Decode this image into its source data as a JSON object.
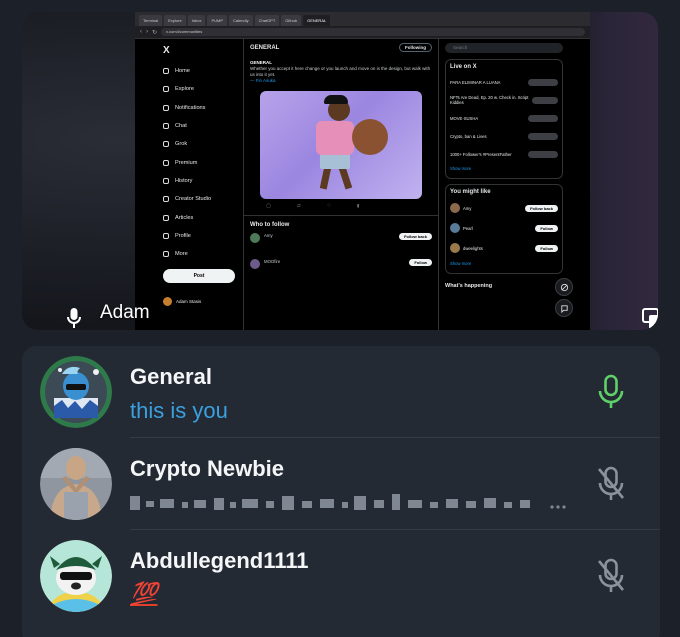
{
  "tile": {
    "name": "Adam",
    "mic_icon": "microphone-icon",
    "copy_icon": "copy-windows-icon"
  },
  "screen": {
    "browser_tabs": [
      "Terminal",
      "Explore",
      "Inbox",
      "PUMP",
      "Calendly",
      "ChatGPT",
      "Github",
      "GENERAL"
    ],
    "url": "x.com/i/communities",
    "x": {
      "logo": "X",
      "nav": [
        "Home",
        "Explore",
        "Notifications",
        "Chat",
        "Grok",
        "Premium",
        "History",
        "Creator Studio",
        "Articles",
        "Profile",
        "More"
      ],
      "post_button": "Post",
      "account_name": "Adam Stasis",
      "main_title": "GENERAL",
      "following_button": "Following",
      "tweet_author": "GENERAL",
      "tweet_text": "Whether you accept it here change or you launch and move on is the design, but walk with us into it yet.",
      "tweet_link": "— Fin Asuka",
      "who_to_follow": "Who to follow",
      "follow_label": "Follow back",
      "follow_label_2": "Follow",
      "follow_name_1": "Amy",
      "follow_name_2": "MOOfire",
      "search_placeholder": "Search",
      "live_title": "Live on X",
      "live_items": [
        "PARA ELIMINAR A LUANA",
        "NFTs Are Dead, Ep. 20 w. Check in. Script Kiddies",
        "MOVE-SUSHA",
        "Crypto, ban & Lives",
        "1000+ Follower's #PresentFather"
      ],
      "show_more": "Show more",
      "yml_title": "You might like",
      "yml_items": [
        "Amy",
        "Pearl",
        "dweelights"
      ],
      "happening_title": "What's happening"
    }
  },
  "participants": [
    {
      "name": "General",
      "status": "this is you",
      "status_color": "#3aa0e0",
      "mic": "mic-active-icon",
      "mic_color": "#5fd16a"
    },
    {
      "name": "Crypto Newbie",
      "status": "",
      "mic": "mic-muted-icon",
      "mic_color": "#8a929c"
    },
    {
      "name": "Abdullegend1111",
      "status": "💯",
      "status_color": "#e0402a",
      "mic": "mic-muted-icon",
      "mic_color": "#8a929c"
    }
  ]
}
